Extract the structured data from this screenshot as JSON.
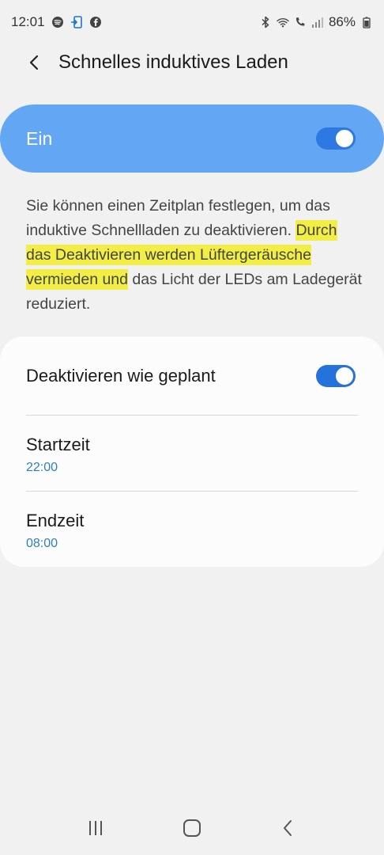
{
  "status_bar": {
    "time": "12:01",
    "battery": "86%",
    "left_icons": [
      "spotify-icon",
      "sim-transfer-icon",
      "facebook-icon"
    ],
    "right_icons": [
      "bluetooth-icon",
      "wifi-icon",
      "call-icon",
      "signal-icon",
      "battery-icon"
    ]
  },
  "header": {
    "title": "Schnelles induktives Laden"
  },
  "master": {
    "label": "Ein",
    "enabled": true,
    "color": "#62a6f4"
  },
  "description": {
    "part1": "Sie können einen Zeitplan festlegen, um das induktive Schnellladen zu deaktivieren. ",
    "highlight": "Durch das Deaktivieren werden Lüftergeräusche vermieden und",
    "part2": " das Licht der LEDs am Ladegerät reduziert."
  },
  "settings": {
    "schedule": {
      "label": "Deaktivieren wie geplant",
      "enabled": true
    },
    "start": {
      "label": "Startzeit",
      "value": "22:00"
    },
    "end": {
      "label": "Endzeit",
      "value": "08:00"
    }
  },
  "colors": {
    "accent": "#2572dc",
    "highlight": "#f2ee45",
    "sub_value": "#2e7fc1"
  }
}
